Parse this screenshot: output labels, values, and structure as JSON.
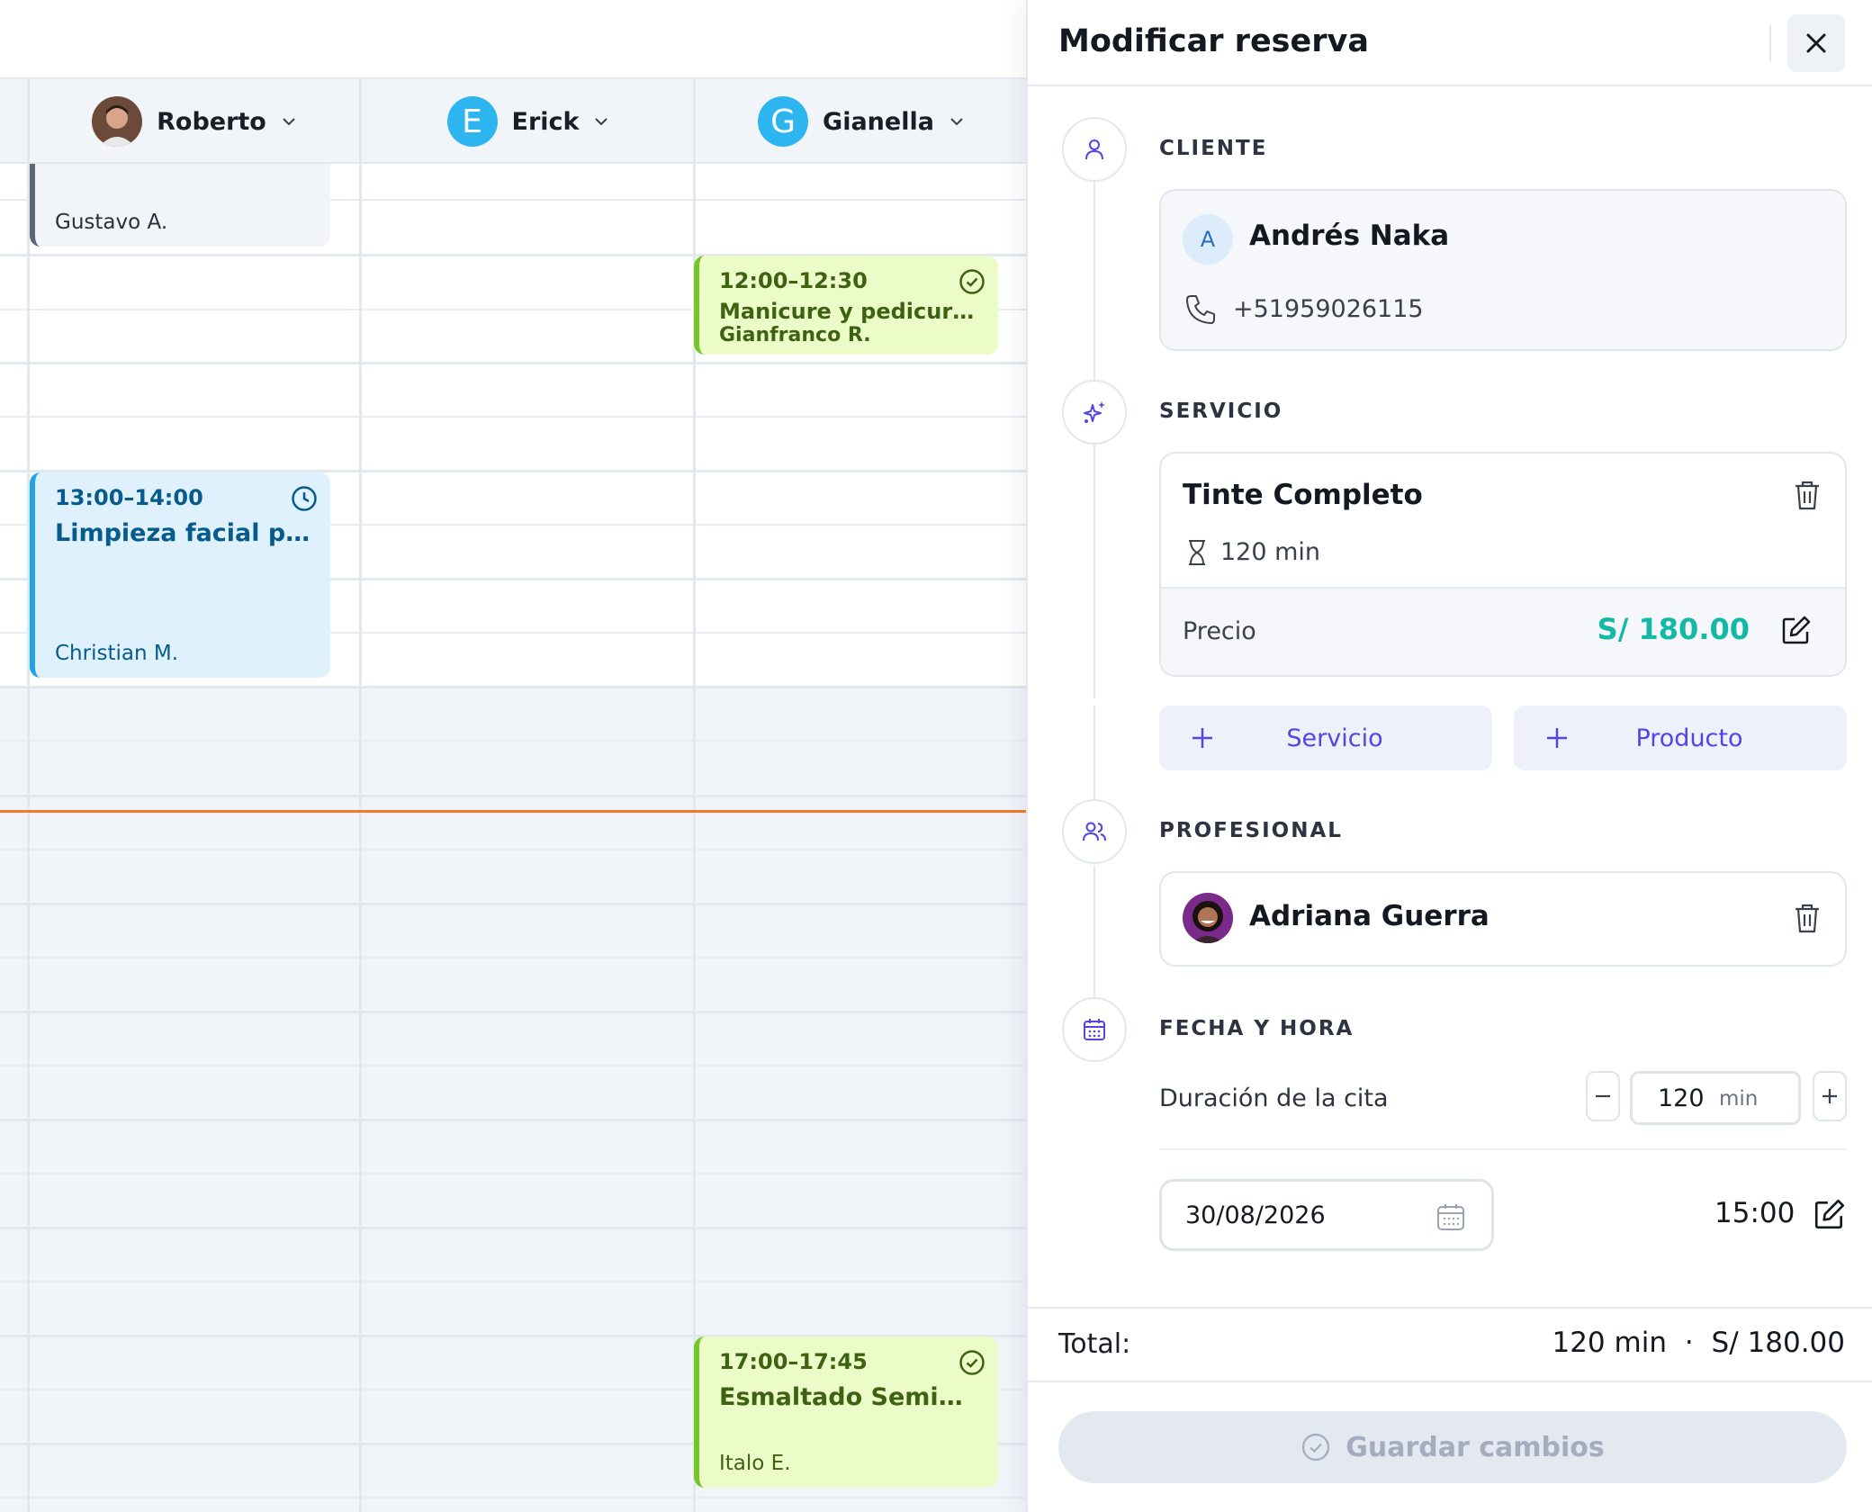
{
  "calendar": {
    "columns": [
      {
        "name": "Roberto",
        "avatar_type": "photo"
      },
      {
        "name": "Erick",
        "avatar_letter": "E"
      },
      {
        "name": "Gianella",
        "avatar_letter": "G"
      }
    ],
    "events": {
      "gustavo": {
        "client": "Gustavo A."
      },
      "manicure": {
        "time": "12:00–12:30",
        "title": "Manicure y pedicure bá...",
        "client": "Gianfranco R.",
        "status_icon": "check-circle-icon"
      },
      "limpieza": {
        "time": "13:00–14:00",
        "title": "Limpieza facial prof...",
        "client": "Christian M.",
        "status_icon": "clock-icon"
      },
      "esmaltado": {
        "time": "17:00–17:45",
        "title": "Esmaltado Semiper...",
        "client": "Italo E.",
        "status_icon": "check-circle-icon"
      }
    },
    "colors": {
      "green": "#76c529",
      "blue": "#1fa3ea",
      "gray": "#5d6675",
      "now_line": "#f07a2c"
    }
  },
  "panel": {
    "title": "Modificar reserva",
    "cliente": {
      "label": "CLIENTE",
      "avatar_letter": "A",
      "name": "Andrés Naka",
      "phone": "+51959026115"
    },
    "servicio": {
      "label": "SERVICIO",
      "name": "Tinte Completo",
      "duration": "120 min",
      "price_label": "Precio",
      "price": "S/ 180.00",
      "add_service": "Servicio",
      "add_product": "Producto"
    },
    "profesional": {
      "label": "PROFESIONAL",
      "name": "Adriana Guerra"
    },
    "fecha": {
      "label": "FECHA Y HORA",
      "duration_label": "Duración de la cita",
      "duration_value": "120",
      "duration_unit": "min",
      "date": "30/08/2026",
      "time": "15:00"
    },
    "footer": {
      "total_label": "Total:",
      "total_duration": "120 min",
      "separator": "·",
      "total_price": "S/ 180.00",
      "save_label": "Guardar cambios"
    },
    "colors": {
      "accent": "#4f46e5",
      "price": "#14b8a6"
    }
  }
}
